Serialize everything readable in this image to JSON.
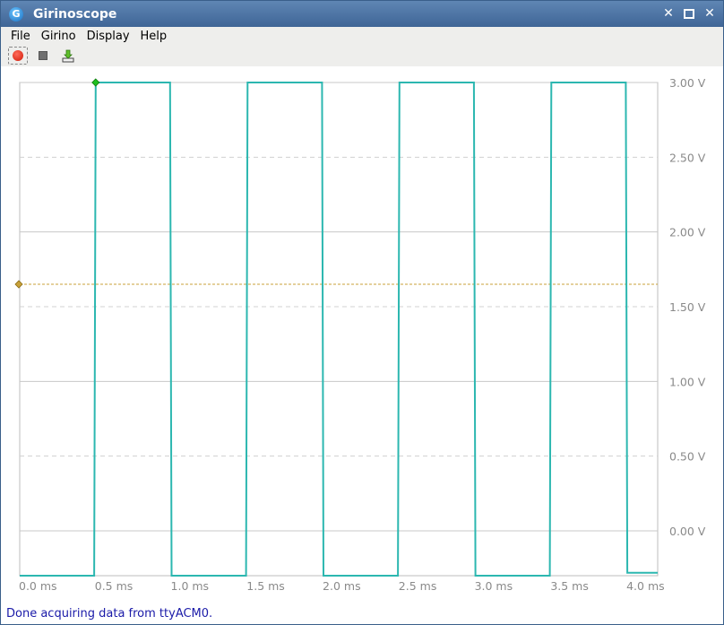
{
  "window": {
    "title": "Girinoscope",
    "app_icon_letter": "G",
    "minimize_glyph": "✕",
    "restore_glyph": "",
    "close_glyph": "✕"
  },
  "menu": [
    "File",
    "Girino",
    "Display",
    "Help"
  ],
  "toolbar": {
    "buttons": [
      "record-icon",
      "stop-icon",
      "export-icon"
    ]
  },
  "status": "Done acquiring data from ttyACM0.",
  "colors": {
    "signal": "#2cb7b0",
    "threshold": "#c8a13a",
    "grid_major": "#c8c8c8",
    "grid_dashed": "#d0d0d0",
    "status_text": "#1a1aa8",
    "trigger_marker": "#1fbf1f"
  },
  "chart_data": {
    "type": "line",
    "title": "",
    "xlabel": "",
    "ylabel": "",
    "x_unit": "ms",
    "y_unit": "V",
    "xlim": [
      0.0,
      4.2
    ],
    "ylim": [
      -0.3,
      3.0
    ],
    "x_ticks": [
      "0.0 ms",
      "0.5 ms",
      "1.0 ms",
      "1.5 ms",
      "2.0 ms",
      "2.5 ms",
      "3.0 ms",
      "3.5 ms",
      "4.0 ms"
    ],
    "x_tick_values": [
      0.0,
      0.5,
      1.0,
      1.5,
      2.0,
      2.5,
      3.0,
      3.5,
      4.0
    ],
    "y_ticks": [
      "3.00 V",
      "2.50 V",
      "2.00 V",
      "1.50 V",
      "1.00 V",
      "0.50 V",
      "0.00 V"
    ],
    "y_tick_values": [
      3.0,
      2.5,
      2.0,
      1.5,
      1.0,
      0.5,
      0.0
    ],
    "threshold_v": 1.65,
    "trigger_x": 0.5,
    "series": [
      {
        "x": [
          0.0,
          0.49,
          0.5,
          0.99,
          1.0,
          1.49,
          1.5,
          1.99,
          2.0,
          2.49,
          2.5,
          2.99,
          3.0,
          3.49,
          3.5,
          3.99,
          4.0,
          4.2
        ],
        "y": [
          -0.3,
          -0.3,
          3.0,
          3.0,
          -0.3,
          -0.3,
          3.0,
          3.0,
          -0.3,
          -0.3,
          3.0,
          3.0,
          -0.3,
          -0.3,
          3.0,
          3.0,
          -0.28,
          -0.28
        ]
      }
    ]
  }
}
